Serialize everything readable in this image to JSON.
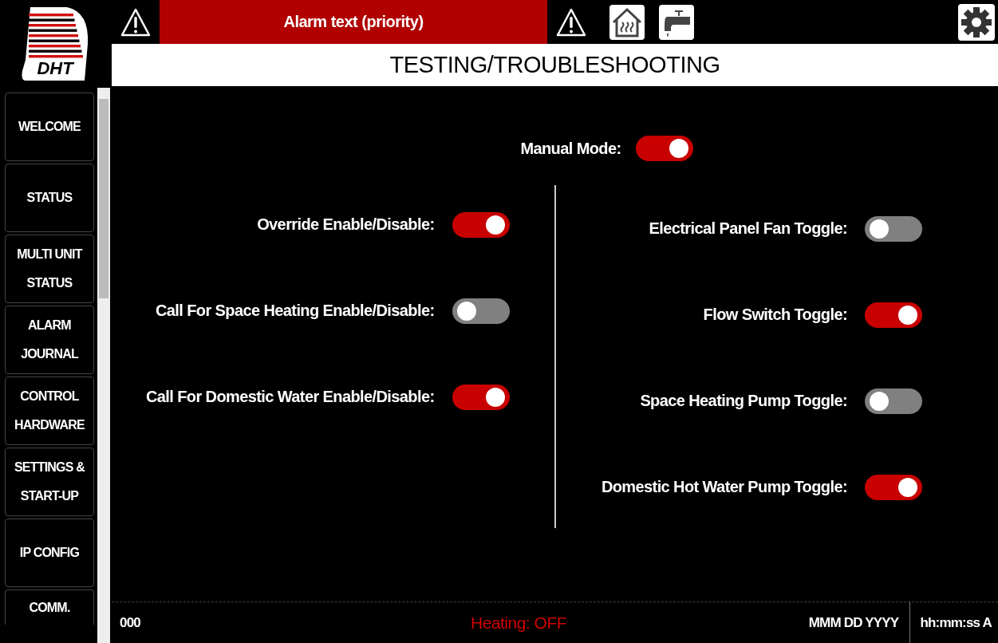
{
  "logo": {
    "text": "DHT"
  },
  "alarm_bar": {
    "text": "Alarm text (priority)"
  },
  "page_title": "TESTING/TROUBLESHOOTING",
  "sidebar": {
    "items": [
      {
        "label": "WELCOME"
      },
      {
        "label": "STATUS"
      },
      {
        "label": "MULTI UNIT STATUS"
      },
      {
        "label": "ALARM JOURNAL"
      },
      {
        "label": "CONTROL HARDWARE"
      },
      {
        "label": "SETTINGS & START-UP"
      },
      {
        "label": "IP CONFIG"
      },
      {
        "label": "COMM."
      }
    ]
  },
  "manual_mode": {
    "label": "Manual Mode:",
    "on": true
  },
  "left_toggles": [
    {
      "label": "Override Enable/Disable:",
      "on": true
    },
    {
      "label": "Call For Space Heating Enable/Disable:",
      "on": false
    },
    {
      "label": "Call For Domestic Water Enable/Disable:",
      "on": true
    }
  ],
  "right_toggles": [
    {
      "label": "Electrical Panel Fan Toggle:",
      "on": false
    },
    {
      "label": "Flow Switch Toggle:",
      "on": true
    },
    {
      "label": "Space Heating Pump Toggle:",
      "on": false
    },
    {
      "label": "Domestic Hot Water Pump Toggle:",
      "on": true
    }
  ],
  "status_bar": {
    "code": "000",
    "heating_status": "Heating: OFF",
    "date": "MMM DD YYYY",
    "time": "hh:mm:ss A"
  }
}
